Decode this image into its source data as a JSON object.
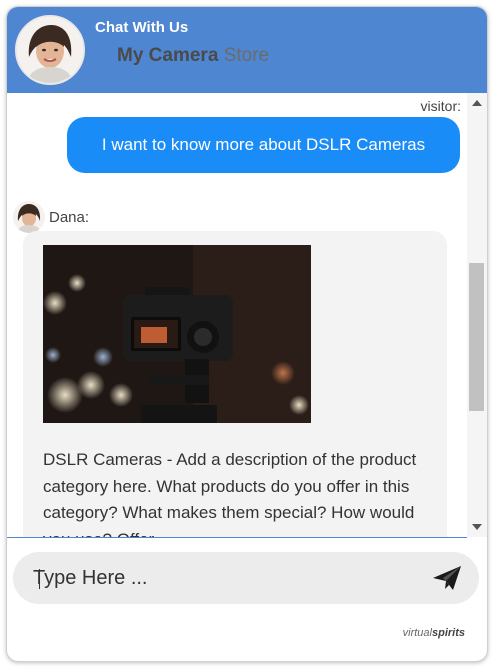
{
  "header": {
    "title": "Chat With Us",
    "store_bold": "My Camera",
    "store_light": "Store"
  },
  "messages": [
    {
      "sender_label": "visitor:",
      "text": "I want to know more about DSLR Cameras"
    },
    {
      "sender_label": "Dana:",
      "text": "DSLR Cameras - Add a description of the product category here. What products do you offer in this category? What makes them special? How would you use? Offer"
    }
  ],
  "composer": {
    "placeholder": "Type Here ..."
  },
  "branding": {
    "light": "virtual",
    "bold": "spirits"
  },
  "colors": {
    "header": "#4f86d1",
    "visitor_bubble": "#1a8cf7",
    "agent_bubble": "#f3f3f3"
  },
  "icons": {
    "send": "paper-plane-icon",
    "scroll_up": "triangle-up-icon",
    "scroll_down": "triangle-down-icon"
  }
}
